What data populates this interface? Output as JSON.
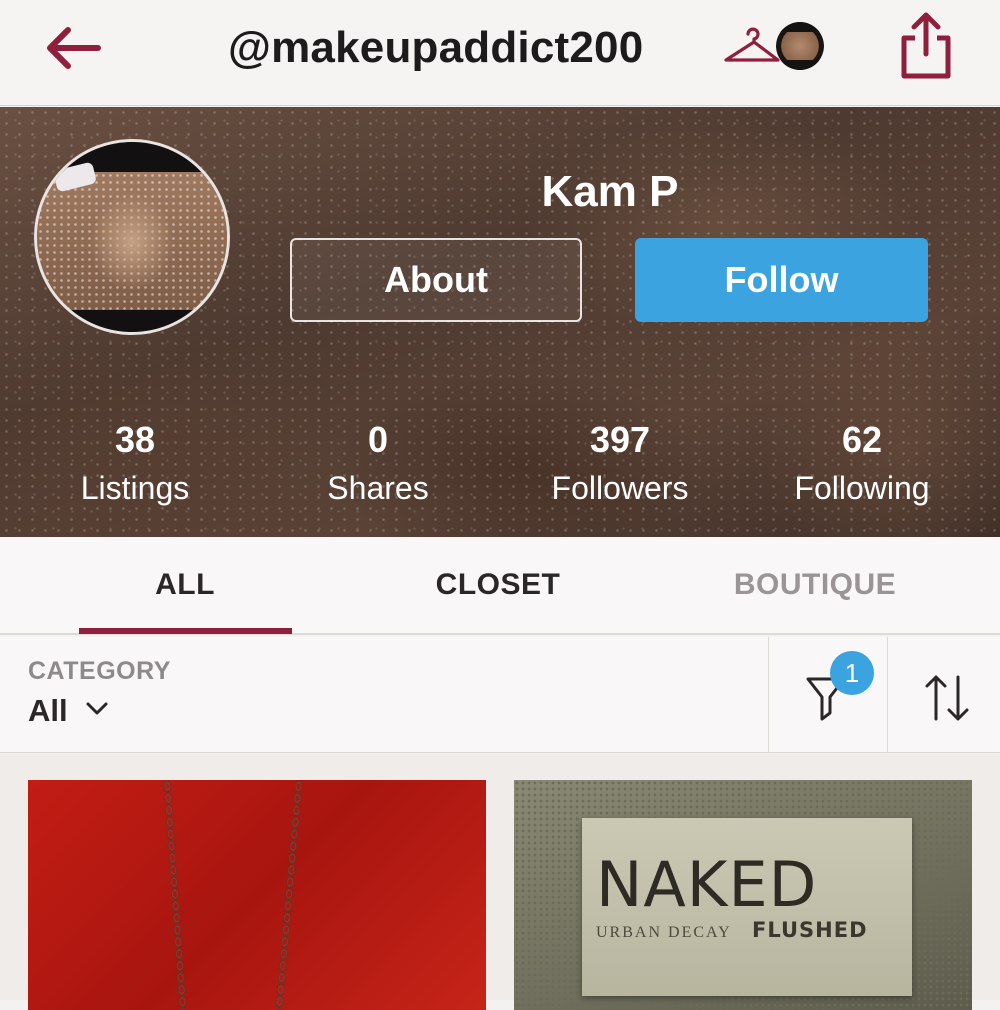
{
  "topbar": {
    "username": "@makeupaddict200"
  },
  "icons": {
    "back": "back-arrow-icon",
    "hanger": "hanger-icon",
    "share": "share-icon",
    "filter": "filter-funnel-icon",
    "sort": "sort-arrows-icon",
    "chevron": "chevron-down-icon"
  },
  "colors": {
    "brand": "#8f1f3c",
    "accent": "#3ba3df"
  },
  "profile": {
    "name": "Kam P",
    "about_label": "About",
    "follow_label": "Follow"
  },
  "stats": [
    {
      "value": "38",
      "label": "Listings"
    },
    {
      "value": "0",
      "label": "Shares"
    },
    {
      "value": "397",
      "label": "Followers"
    },
    {
      "value": "62",
      "label": "Following"
    }
  ],
  "tabs": [
    {
      "label": "ALL",
      "active": true
    },
    {
      "label": "CLOSET",
      "active": false
    },
    {
      "label": "BOUTIQUE",
      "active": false
    }
  ],
  "filter": {
    "category_label": "CATEGORY",
    "category_value": "All",
    "badge_count": "1"
  },
  "listings": [
    {
      "image": "red-fabric-chain-necklace"
    },
    {
      "image": "naked-palette",
      "brand_text": "NAKED",
      "sub_text": "URBAN DECAY",
      "line_text": "FLUSHED"
    }
  ]
}
